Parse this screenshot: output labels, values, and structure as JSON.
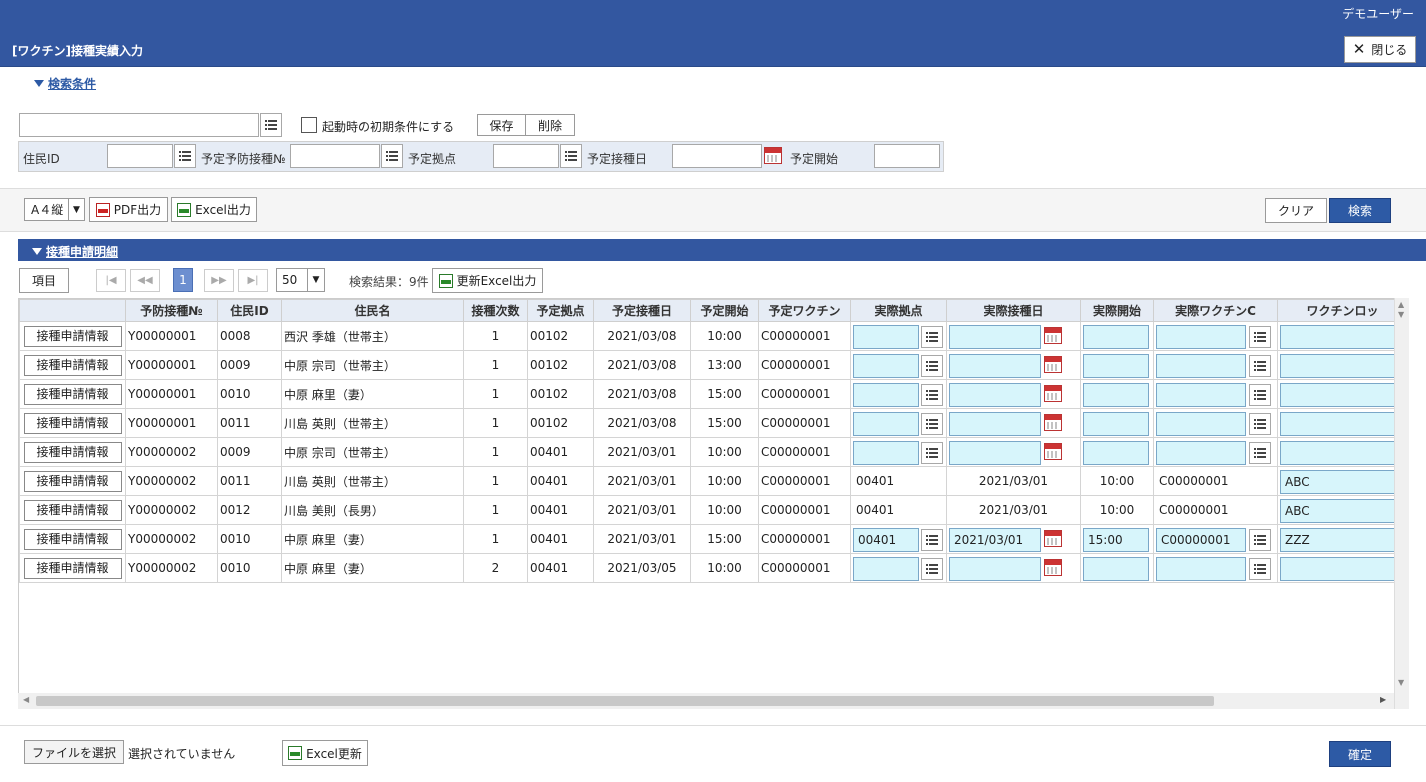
{
  "window": {
    "title": "[ワクチン]接種実績入力",
    "user": "デモユーザー",
    "close_label": "閉じる"
  },
  "search": {
    "section_label": "検索条件",
    "init_label": "起動時の初期条件にする",
    "save_label": "保存",
    "delete_label": "削除",
    "fields": {
      "resident_id": "住民ID",
      "planned_vaccination_no": "予定予防接種№",
      "planned_site": "予定拠点",
      "planned_date": "予定接種日",
      "planned_start": "予定開始"
    }
  },
  "toolbar": {
    "paper_size": "A４縦",
    "pdf_label": "PDF出力",
    "excel_label": "Excel出力",
    "clear_label": "クリア",
    "search_label": "検索"
  },
  "detail": {
    "section_label": "接種申請明細",
    "columns_label": "項目",
    "current_page": "1",
    "page_size": "50",
    "result_text": "検索結果：9件",
    "update_excel_label": "更新Excel出力"
  },
  "grid": {
    "headers": [
      "",
      "予防接種№",
      "住民ID",
      "住民名",
      "接種次数",
      "予定拠点",
      "予定接種日",
      "予定開始",
      "予定ワクチン",
      "実際拠点",
      "実際接種日",
      "実際開始",
      "実際ワクチンC",
      "ワクチンロッ"
    ],
    "row_button_label": "接種申請情報",
    "rows": [
      {
        "no": "Y00000001",
        "rid": "0008",
        "name": "西沢 季雄（世帯主）",
        "times": "1",
        "site": "00102",
        "date": "2021/03/08",
        "start": "10:00",
        "vaccine": "C00000001",
        "mode": "input",
        "a_site": "",
        "a_date": "",
        "a_start": "",
        "a_vac": "",
        "lot": ""
      },
      {
        "no": "Y00000001",
        "rid": "0009",
        "name": "中原 宗司（世帯主）",
        "times": "1",
        "site": "00102",
        "date": "2021/03/08",
        "start": "13:00",
        "vaccine": "C00000001",
        "mode": "input",
        "a_site": "",
        "a_date": "",
        "a_start": "",
        "a_vac": "",
        "lot": ""
      },
      {
        "no": "Y00000001",
        "rid": "0010",
        "name": "中原 麻里（妻）",
        "times": "1",
        "site": "00102",
        "date": "2021/03/08",
        "start": "15:00",
        "vaccine": "C00000001",
        "mode": "input",
        "a_site": "",
        "a_date": "",
        "a_start": "",
        "a_vac": "",
        "lot": ""
      },
      {
        "no": "Y00000001",
        "rid": "0011",
        "name": "川島 英則（世帯主）",
        "times": "1",
        "site": "00102",
        "date": "2021/03/08",
        "start": "15:00",
        "vaccine": "C00000001",
        "mode": "input",
        "a_site": "",
        "a_date": "",
        "a_start": "",
        "a_vac": "",
        "lot": ""
      },
      {
        "no": "Y00000002",
        "rid": "0009",
        "name": "中原 宗司（世帯主）",
        "times": "1",
        "site": "00401",
        "date": "2021/03/01",
        "start": "10:00",
        "vaccine": "C00000001",
        "mode": "input",
        "a_site": "",
        "a_date": "",
        "a_start": "",
        "a_vac": "",
        "lot": ""
      },
      {
        "no": "Y00000002",
        "rid": "0011",
        "name": "川島 英則（世帯主）",
        "times": "1",
        "site": "00401",
        "date": "2021/03/01",
        "start": "10:00",
        "vaccine": "C00000001",
        "mode": "text",
        "a_site": "00401",
        "a_date": "2021/03/01",
        "a_start": "10:00",
        "a_vac": "C00000001",
        "lot": "ABC"
      },
      {
        "no": "Y00000002",
        "rid": "0012",
        "name": "川島 美則（長男）",
        "times": "1",
        "site": "00401",
        "date": "2021/03/01",
        "start": "10:00",
        "vaccine": "C00000001",
        "mode": "text",
        "a_site": "00401",
        "a_date": "2021/03/01",
        "a_start": "10:00",
        "a_vac": "C00000001",
        "lot": "ABC"
      },
      {
        "no": "Y00000002",
        "rid": "0010",
        "name": "中原 麻里（妻）",
        "times": "1",
        "site": "00401",
        "date": "2021/03/01",
        "start": "15:00",
        "vaccine": "C00000001",
        "mode": "input",
        "a_site": "00401",
        "a_date": "2021/03/01",
        "a_start": "15:00",
        "a_vac": "C00000001",
        "lot": "ZZZ"
      },
      {
        "no": "Y00000002",
        "rid": "0010",
        "name": "中原 麻里（妻）",
        "times": "2",
        "site": "00401",
        "date": "2021/03/05",
        "start": "10:00",
        "vaccine": "C00000001",
        "mode": "input",
        "a_site": "",
        "a_date": "",
        "a_start": "",
        "a_vac": "",
        "lot": ""
      }
    ]
  },
  "footer": {
    "file_button": "ファイルを選択",
    "file_status": "選択されていません",
    "excel_update": "Excel更新",
    "confirm": "確定"
  },
  "colors": {
    "header_blue": "#3357a0",
    "accent": "#2d5aa5",
    "editable": "#d7f5fb",
    "label_bg": "#e6ecf5"
  }
}
